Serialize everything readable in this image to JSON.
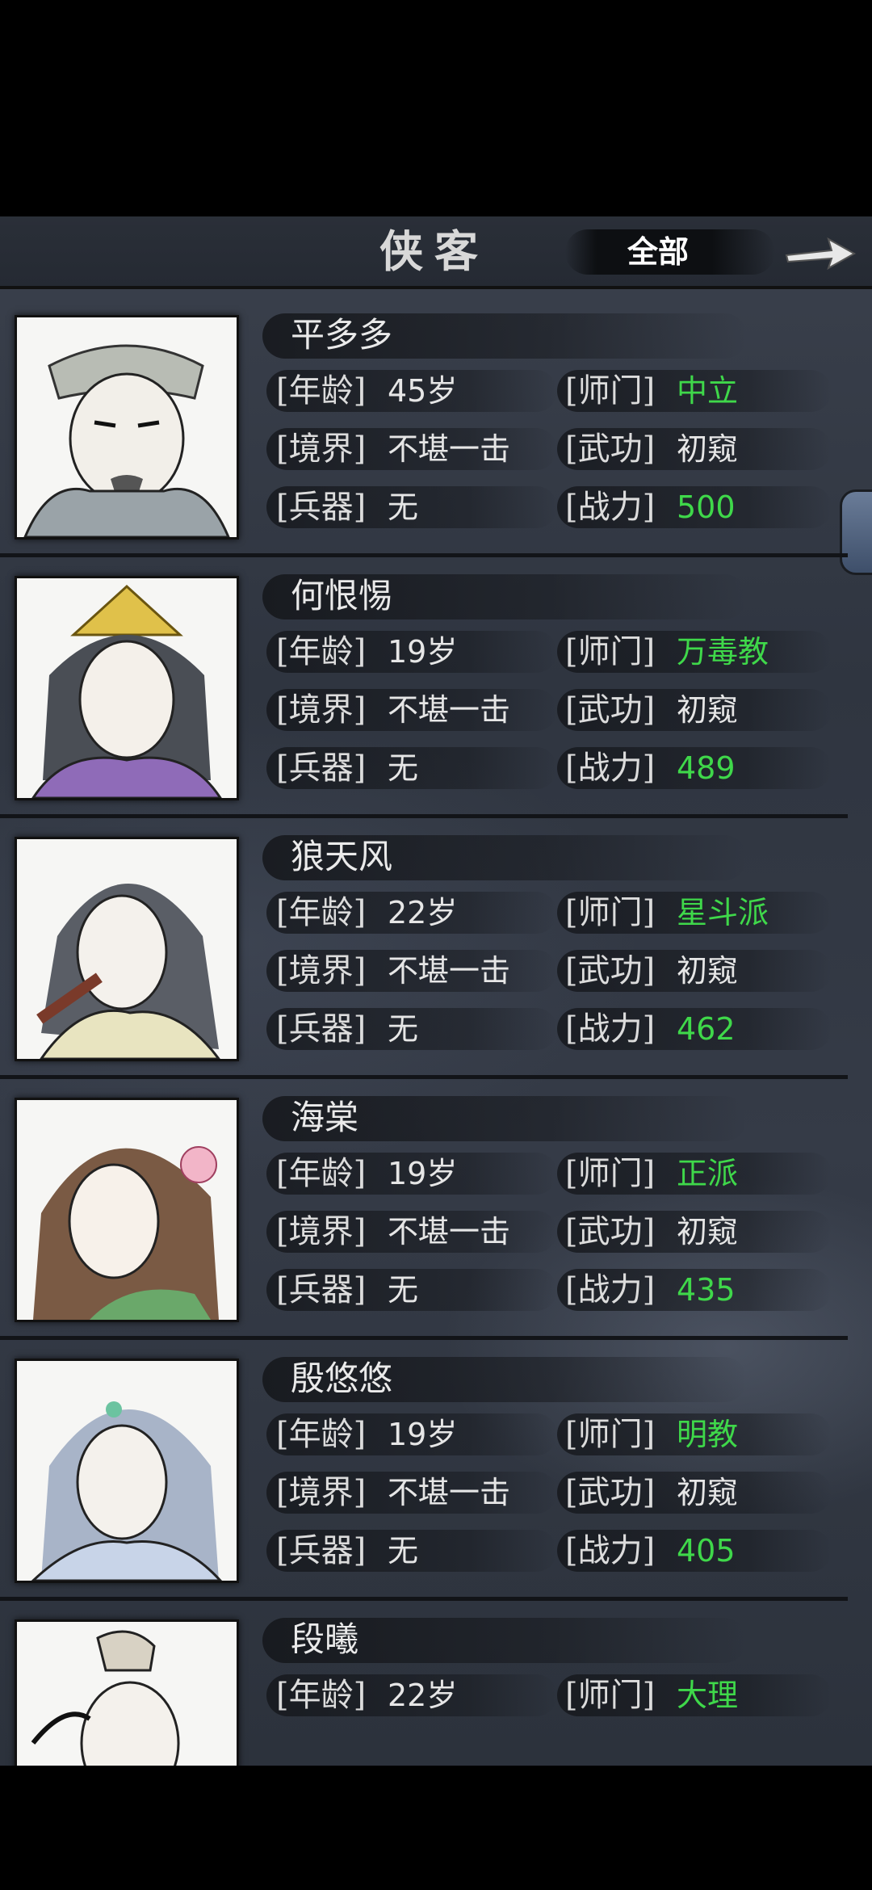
{
  "header": {
    "title": "侠客",
    "filter_label": "全部"
  },
  "labels": {
    "age": "[年龄]",
    "sect": "[师门]",
    "realm": "[境界]",
    "martial": "[武功]",
    "weapon": "[兵器]",
    "power": "[战力]"
  },
  "heroes": [
    {
      "name": "平多多",
      "age": "45岁",
      "sect": "中立",
      "realm": "不堪一击",
      "martial": "初窥",
      "weapon": "无",
      "power": "500"
    },
    {
      "name": "何恨惕",
      "age": "19岁",
      "sect": "万毒教",
      "realm": "不堪一击",
      "martial": "初窥",
      "weapon": "无",
      "power": "489"
    },
    {
      "name": "狼天风",
      "age": "22岁",
      "sect": "星斗派",
      "realm": "不堪一击",
      "martial": "初窥",
      "weapon": "无",
      "power": "462"
    },
    {
      "name": "海棠",
      "age": "19岁",
      "sect": "正派",
      "realm": "不堪一击",
      "martial": "初窥",
      "weapon": "无",
      "power": "435"
    },
    {
      "name": "殷悠悠",
      "age": "19岁",
      "sect": "明教",
      "realm": "不堪一击",
      "martial": "初窥",
      "weapon": "无",
      "power": "405"
    },
    {
      "name": "段曦",
      "age": "22岁",
      "sect": "大理"
    }
  ],
  "colors": {
    "accent_green": "#3fd84a",
    "panel_bg": "#353b47"
  }
}
